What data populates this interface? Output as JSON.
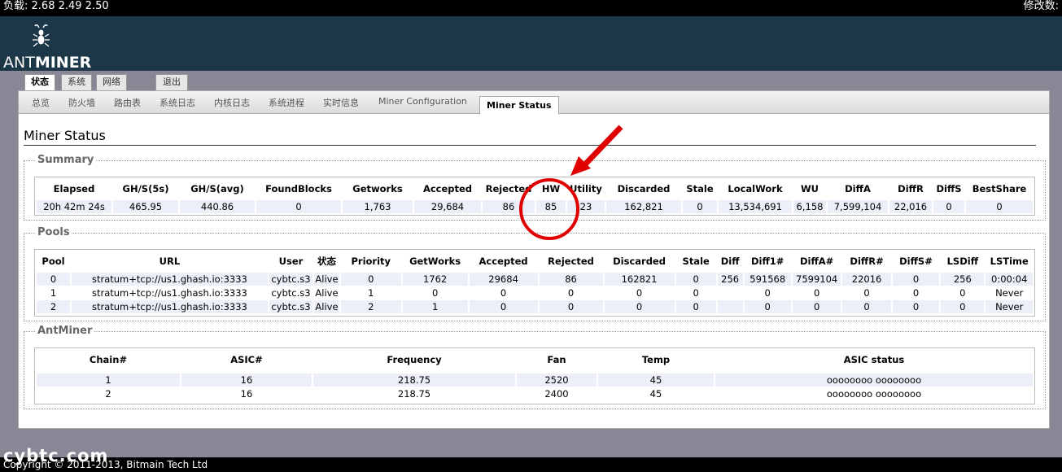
{
  "topbar": {
    "load_label": "负载:",
    "load_value": "2.68 2.49 2.50",
    "changes_label": "修改数:"
  },
  "logo": {
    "ant": "ANT",
    "miner": "MINER"
  },
  "tabs": [
    {
      "label": "状态",
      "active": true
    },
    {
      "label": "系统"
    },
    {
      "label": "网络"
    },
    {
      "label": "退出"
    }
  ],
  "subtabs": [
    {
      "label": "总览"
    },
    {
      "label": "防火墙"
    },
    {
      "label": "路由表"
    },
    {
      "label": "系统日志"
    },
    {
      "label": "内核日志"
    },
    {
      "label": "系统进程"
    },
    {
      "label": "实时信息"
    },
    {
      "label": "Miner Configuration"
    },
    {
      "label": "Miner Status",
      "active": true
    }
  ],
  "page_title": "Miner Status",
  "summary": {
    "legend": "Summary",
    "headers": [
      "Elapsed",
      "GH/S(5s)",
      "GH/S(avg)",
      "FoundBlocks",
      "Getworks",
      "Accepted",
      "Rejected",
      "HW",
      "Utility",
      "Discarded",
      "Stale",
      "LocalWork",
      "WU",
      "DiffA",
      "DiffR",
      "DiffS",
      "BestShare"
    ],
    "row": [
      "20h 42m 24s",
      "465.95",
      "440.86",
      "0",
      "1,763",
      "29,684",
      "86",
      "85",
      "23",
      "162,821",
      "0",
      "13,534,691",
      "6,158",
      "7,599,104",
      "22,016",
      "0",
      "0"
    ]
  },
  "pools": {
    "legend": "Pools",
    "headers": [
      "Pool",
      "URL",
      "User",
      "状态",
      "Priority",
      "GetWorks",
      "Accepted",
      "Rejected",
      "Discarded",
      "Stale",
      "Diff",
      "Diff1#",
      "DiffA#",
      "DiffR#",
      "DiffS#",
      "LSDiff",
      "LSTime"
    ],
    "rows": [
      [
        "0",
        "stratum+tcp://us1.ghash.io:3333",
        "cybtc.s3",
        "Alive",
        "0",
        "1762",
        "29684",
        "86",
        "162821",
        "0",
        "256",
        "591568",
        "7599104",
        "22016",
        "0",
        "256",
        "0:00:04"
      ],
      [
        "1",
        "stratum+tcp://us1.ghash.io:3333",
        "cybtc.s3",
        "Alive",
        "1",
        "0",
        "0",
        "0",
        "0",
        "0",
        "",
        "0",
        "0",
        "0",
        "0",
        "0",
        "Never"
      ],
      [
        "2",
        "stratum+tcp://us1.ghash.io:3333",
        "cybtc.s3",
        "Alive",
        "2",
        "1",
        "0",
        "0",
        "0",
        "0",
        "",
        "0",
        "0",
        "0",
        "0",
        "0",
        "Never"
      ]
    ]
  },
  "antminer": {
    "legend": "AntMiner",
    "headers": [
      "Chain#",
      "ASIC#",
      "Frequency",
      "Fan",
      "Temp",
      "ASIC status"
    ],
    "rows": [
      [
        "1",
        "16",
        "218.75",
        "2520",
        "45",
        "oooooooo oooooooo"
      ],
      [
        "2",
        "16",
        "218.75",
        "2400",
        "45",
        "oooooooo oooooooo"
      ]
    ]
  },
  "footer": {
    "copyright": "Copyright © 2011-2013, Bitmain Tech Ltd"
  },
  "watermark": "cybtc.com",
  "colors": {
    "header_bg": "#1c3748",
    "page_bg": "#8a8696",
    "annotation": "#e00000",
    "odd_row": "#eceef8"
  }
}
